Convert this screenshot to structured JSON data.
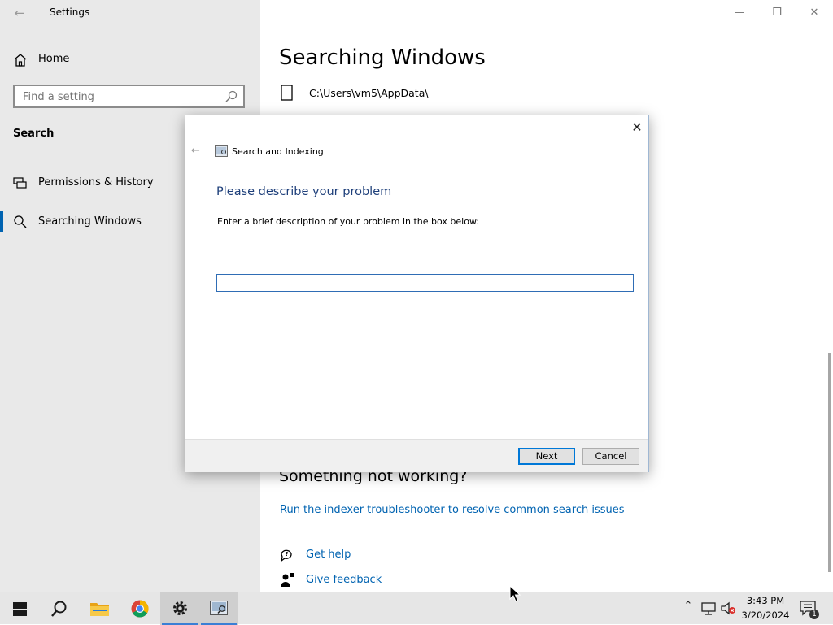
{
  "settings": {
    "title": "Settings",
    "home_label": "Home",
    "search_placeholder": "Find a setting",
    "section_heading": "Search",
    "nav_items": [
      {
        "label": "Permissions & History",
        "icon": "permissions-icon"
      },
      {
        "label": "Searching Windows",
        "icon": "search-icon",
        "selected": true
      }
    ]
  },
  "main": {
    "page_title": "Searching Windows",
    "excluded_folder_path": "C:\\Users\\vm5\\AppData\\",
    "not_working_heading": "Something not working?",
    "troubleshooter_link": "Run the indexer troubleshooter to resolve common search issues",
    "get_help_label": "Get help",
    "give_feedback_label": "Give feedback"
  },
  "dialog": {
    "app_title": "Search and Indexing",
    "heading": "Please describe your problem",
    "instruction": "Enter a brief description of your problem in the box below:",
    "input_value": "",
    "next_label": "Next",
    "cancel_label": "Cancel"
  },
  "taskbar": {
    "apps": [
      "start-icon",
      "search-icon",
      "file-explorer-icon",
      "chrome-icon",
      "settings-gear-icon",
      "troubleshooter-icon"
    ],
    "time": "3:43 PM",
    "date": "3/20/2024",
    "notification_count": "1"
  },
  "colors": {
    "accent": "#0063b1",
    "sidebar_bg": "#e9e9e9",
    "dialog_heading": "#1e3f7a",
    "taskbar_bg": "#e6e6e6"
  }
}
